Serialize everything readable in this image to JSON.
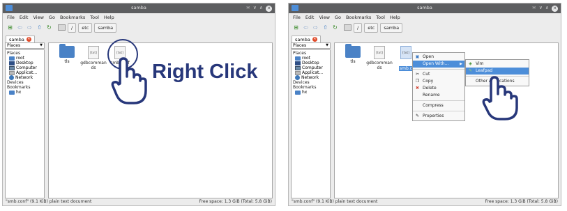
{
  "windows": [
    {
      "title": "samba",
      "menu": [
        "File",
        "Edit",
        "View",
        "Go",
        "Bookmarks",
        "Tool",
        "Help"
      ],
      "path": [
        "/",
        "etc",
        "samba"
      ],
      "tab": "samba",
      "sidebar_header": "Places",
      "sidebar": [
        {
          "kind": "section",
          "label": "Places"
        },
        {
          "kind": "item",
          "label": "root",
          "icon": "folder-icon"
        },
        {
          "kind": "item",
          "label": "Desktop",
          "icon": "desktop-icon"
        },
        {
          "kind": "item",
          "label": "Computer",
          "icon": "computer-icon"
        },
        {
          "kind": "item",
          "label": "Applicat...",
          "icon": "applications-icon"
        },
        {
          "kind": "item",
          "label": "Network",
          "icon": "network-icon"
        },
        {
          "kind": "section",
          "label": "Devices"
        },
        {
          "kind": "section",
          "label": "Bookmarks"
        },
        {
          "kind": "item",
          "label": "hx",
          "icon": "folder-icon"
        }
      ],
      "files": [
        {
          "name": "tls",
          "type": "folder"
        },
        {
          "name": "gdbcommands",
          "type": "text"
        },
        {
          "name": "smb.conf",
          "type": "text"
        }
      ],
      "status_left": "\"smb.conf\" (9.1 KiB) plain text document",
      "status_right": "Free space: 1.3 GiB (Total: 5.8 GiB)"
    },
    {
      "title": "samba",
      "menu": [
        "File",
        "Edit",
        "View",
        "Go",
        "Bookmarks",
        "Tool",
        "Help"
      ],
      "path": [
        "/",
        "etc",
        "samba"
      ],
      "tab": "samba",
      "sidebar_header": "Places",
      "sidebar": [
        {
          "kind": "section",
          "label": "Places"
        },
        {
          "kind": "item",
          "label": "root",
          "icon": "folder-icon"
        },
        {
          "kind": "item",
          "label": "Desktop",
          "icon": "desktop-icon"
        },
        {
          "kind": "item",
          "label": "Computer",
          "icon": "computer-icon"
        },
        {
          "kind": "item",
          "label": "Applicat...",
          "icon": "applications-icon"
        },
        {
          "kind": "item",
          "label": "Network",
          "icon": "network-icon"
        },
        {
          "kind": "section",
          "label": "Devices"
        },
        {
          "kind": "section",
          "label": "Bookmarks"
        },
        {
          "kind": "item",
          "label": "hx",
          "icon": "folder-icon"
        }
      ],
      "files": [
        {
          "name": "tls",
          "type": "folder"
        },
        {
          "name": "gdbcommands",
          "type": "text"
        },
        {
          "name": "smb.c",
          "type": "text"
        }
      ],
      "status_left": "\"smb.conf\" (9.1 KiB) plain text document",
      "status_right": "Free space: 1.3 GiB (Total: 5.8 GiB)"
    }
  ],
  "annotation": {
    "text": "Right Click",
    "color": "#27377a"
  },
  "context_menu": [
    {
      "label": "Open",
      "icon": "open-icon"
    },
    {
      "label": "Open With...",
      "highlighted": true,
      "submenu": true
    },
    {
      "label": "Cut",
      "icon": "cut-icon"
    },
    {
      "label": "Copy",
      "icon": "copy-icon"
    },
    {
      "label": "Delete",
      "icon": "delete-icon"
    },
    {
      "label": "Rename"
    },
    {
      "label": "Compress"
    },
    {
      "label": "Properties",
      "icon": "properties-icon"
    }
  ],
  "submenu": [
    {
      "label": "Vim",
      "icon": "vim-icon"
    },
    {
      "label": "Leafpad",
      "icon": "leafpad-icon",
      "highlighted": true
    },
    {
      "label": "Other Applications"
    }
  ],
  "colors": {
    "accent": "#4d8ed9",
    "titlebar": "#5d5e60",
    "annotation": "#27377a",
    "folder": "#4a82c6"
  }
}
